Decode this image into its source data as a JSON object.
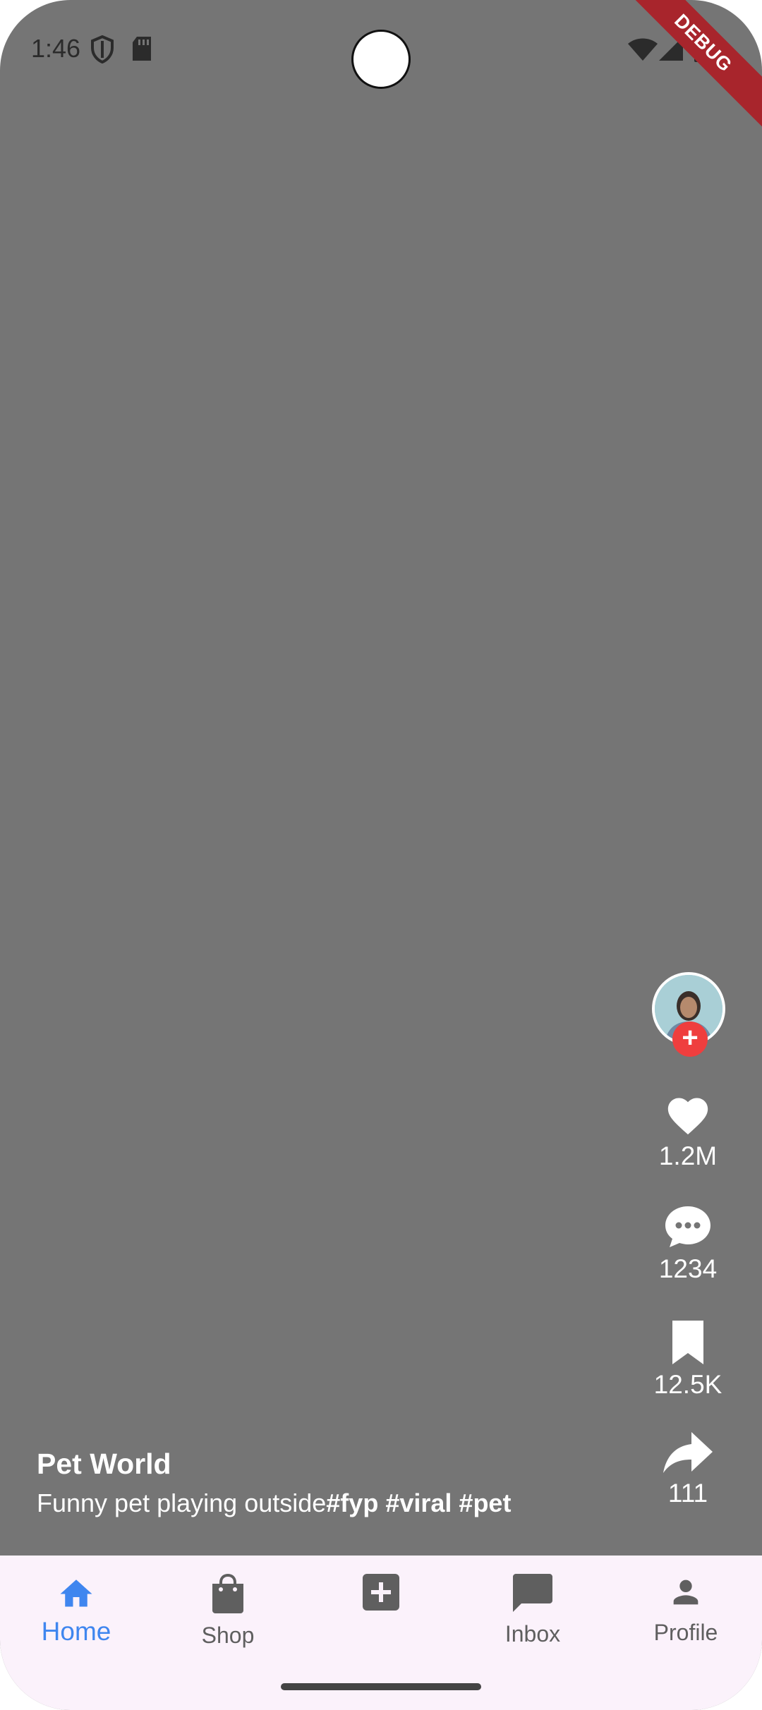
{
  "status_bar": {
    "time": "1:46",
    "debug_banner": "DEBUG"
  },
  "video": {
    "author": "Pet World",
    "caption_text": "Funny pet playing outside",
    "hashtags": [
      "#fyp",
      "#viral",
      "#pet"
    ]
  },
  "actions": {
    "likes": "1.2M",
    "comments": "1234",
    "bookmarks": "12.5K",
    "shares": "111"
  },
  "bottom_nav": {
    "items": [
      {
        "label": "Home",
        "icon": "home-icon",
        "active": true
      },
      {
        "label": "Shop",
        "icon": "shopping-bag-icon",
        "active": false
      },
      {
        "label": "",
        "icon": "add-box-icon",
        "active": false
      },
      {
        "label": "Inbox",
        "icon": "chat-icon",
        "active": false
      },
      {
        "label": "Profile",
        "icon": "person-icon",
        "active": false
      }
    ]
  },
  "colors": {
    "background": "#757575",
    "accent": "#3f86ef",
    "follow": "#ef3e3e",
    "nav_bg": "#fbf2fb"
  }
}
